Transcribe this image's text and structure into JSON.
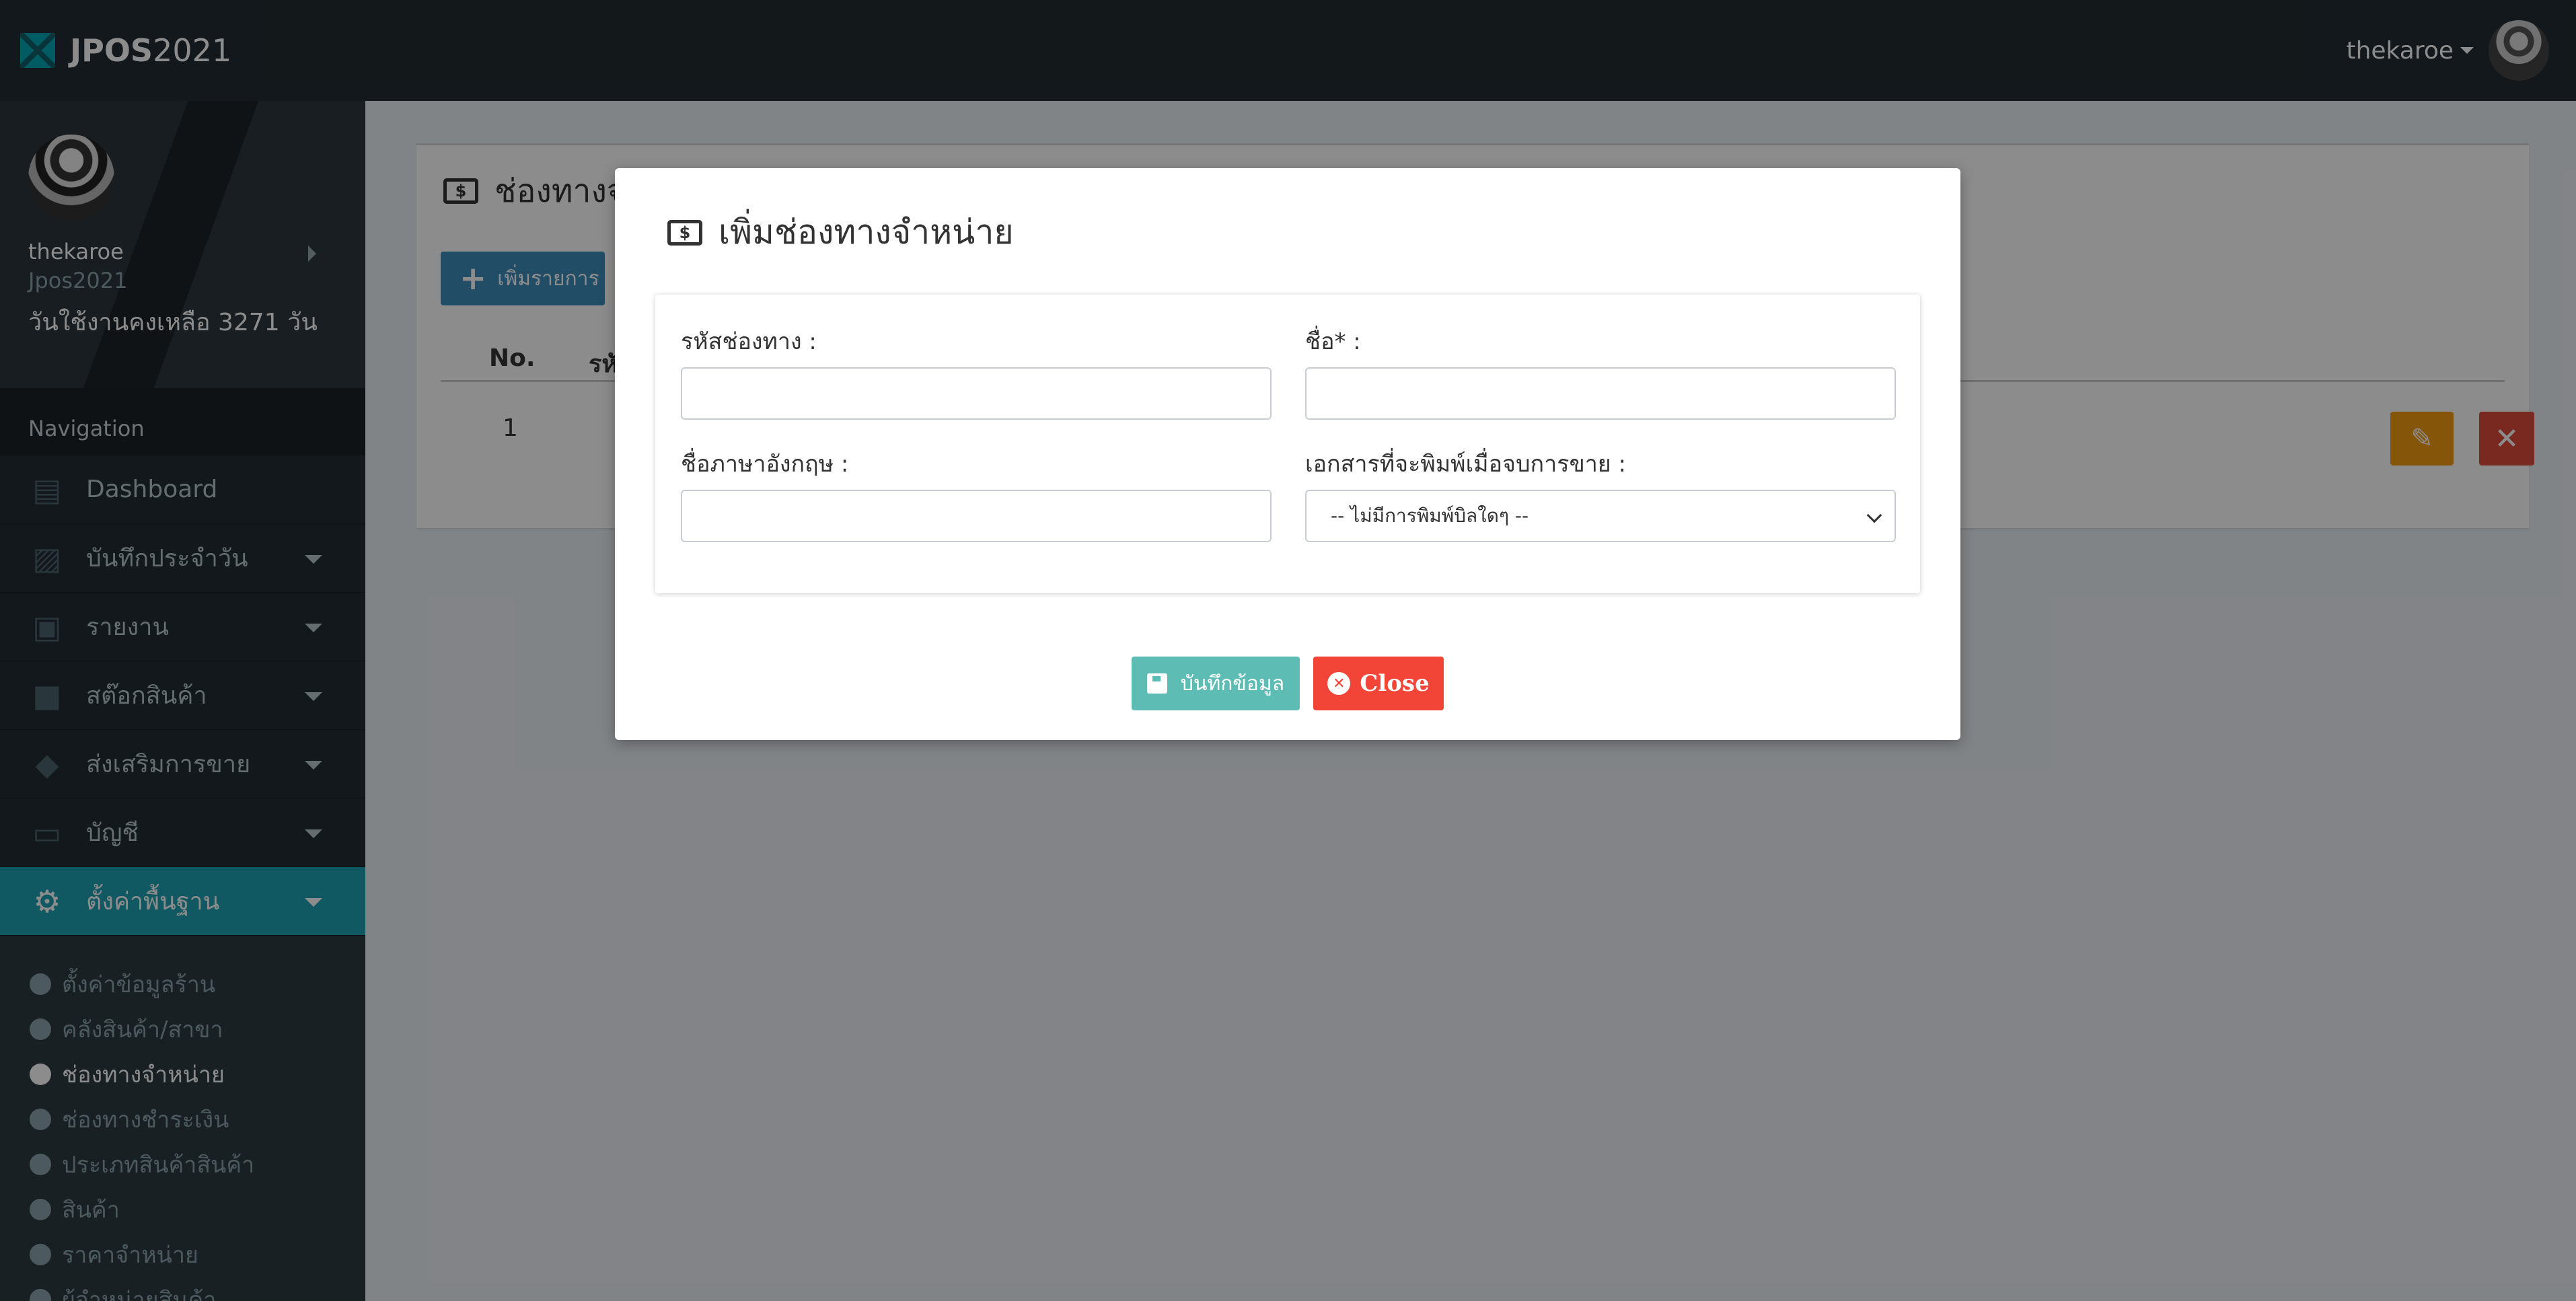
{
  "app": {
    "brand_bold": "JPOS",
    "brand_light": "2021"
  },
  "topbar": {
    "username": "thekaroe"
  },
  "sidebar": {
    "user": {
      "name": "thekaroe",
      "app": "Jpos2021",
      "days_left": "วันใช้งานคงเหลือ 3271 วัน"
    },
    "nav_header": "Navigation",
    "items": [
      {
        "label": "Dashboard",
        "icon": "chart-icon"
      },
      {
        "label": "บันทึกประจำวัน",
        "icon": "register-icon"
      },
      {
        "label": "รายงาน",
        "icon": "monitor-icon"
      },
      {
        "label": "สต๊อกสินค้า",
        "icon": "box-icon"
      },
      {
        "label": "ส่งเสริมการขาย",
        "icon": "tags-icon"
      },
      {
        "label": "บัญชี",
        "icon": "laptop-icon"
      },
      {
        "label": "ตั้งค่าพื้นฐาน",
        "icon": "gear-icon"
      }
    ],
    "submenu": [
      "ตั้งค่าข้อมูลร้าน",
      "คลังสินค้า/สาขา",
      "ช่องทางจำหน่าย",
      "ช่องทางชำระเงิน",
      "ประเภทสินค้าสินค้า",
      "สินค้า",
      "ราคาจำหน่าย",
      "ผู้จำหน่ายสินค้า"
    ]
  },
  "page": {
    "title": "ช่องทางจำหน่าย",
    "add_button": "เพิ่มรายการ",
    "table": {
      "headers": [
        "No.",
        "รหัสช่องทาง"
      ],
      "rows": [
        {
          "no": "1"
        }
      ]
    }
  },
  "modal": {
    "title": "เพิ่มช่องทางจำหน่าย",
    "fields": {
      "code_label": "รหัสช่องทาง :",
      "name_label": "ชื่อ* :",
      "name_en_label": "ชื่อภาษาอังกฤษ :",
      "print_doc_label": "เอกสารที่จะพิมพ์เมื่อจบการขาย :",
      "print_doc_value": "-- ไม่มีการพิมพ์บิลใดๆ --"
    },
    "save_button": "บันทึกข้อมูล",
    "close_button": "Close"
  },
  "colors": {
    "accent": "#1fa3b3",
    "primary": "#3c8dbc",
    "warning": "#f39c12",
    "danger": "#dd4b39",
    "save": "#5dbdb4"
  }
}
